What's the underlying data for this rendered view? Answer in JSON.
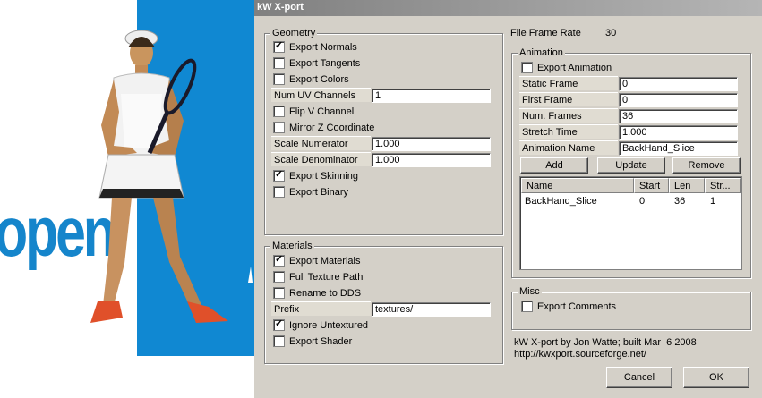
{
  "window": {
    "title": "kW X-port"
  },
  "geometry": {
    "title": "Geometry",
    "export_normals": {
      "label": "Export Normals",
      "checked": true
    },
    "export_tangents": {
      "label": "Export Tangents",
      "checked": false
    },
    "export_colors": {
      "label": "Export Colors",
      "checked": false
    },
    "num_uv_channels": {
      "label": "Num UV Channels",
      "value": "1"
    },
    "flip_v": {
      "label": "Flip V Channel",
      "checked": false
    },
    "mirror_z": {
      "label": "Mirror Z Coordinate",
      "checked": false
    },
    "scale_numerator": {
      "label": "Scale Numerator",
      "value": "1.000"
    },
    "scale_denominator": {
      "label": "Scale Denominator",
      "value": "1.000"
    },
    "export_skinning": {
      "label": "Export Skinning",
      "checked": true
    },
    "export_binary": {
      "label": "Export Binary",
      "checked": false
    }
  },
  "materials": {
    "title": "Materials",
    "export_materials": {
      "label": "Export Materials",
      "checked": true
    },
    "full_texture_path": {
      "label": "Full Texture Path",
      "checked": false
    },
    "rename_to_dds": {
      "label": "Rename to DDS",
      "checked": false
    },
    "prefix": {
      "label": "Prefix",
      "value": "textures/"
    },
    "ignore_untextured": {
      "label": "Ignore Untextured",
      "checked": true
    },
    "export_shader": {
      "label": "Export Shader",
      "checked": false
    }
  },
  "file_frame_rate": {
    "label": "File Frame Rate",
    "value": "30"
  },
  "animation": {
    "title": "Animation",
    "export_animation": {
      "label": "Export Animation",
      "checked": false
    },
    "static_frame": {
      "label": "Static Frame",
      "value": "0"
    },
    "first_frame": {
      "label": "First Frame",
      "value": "0"
    },
    "num_frames": {
      "label": "Num. Frames",
      "value": "36"
    },
    "stretch_time": {
      "label": "Stretch Time",
      "value": "1.000"
    },
    "animation_name": {
      "label": "Animation Name",
      "value": "BackHand_Slice"
    },
    "add_label": "Add",
    "update_label": "Update",
    "remove_label": "Remove",
    "list_columns": [
      "Name",
      "Start",
      "Len",
      "Str..."
    ],
    "list_rows": [
      [
        "BackHand_Slice",
        "0",
        "36",
        "1"
      ]
    ]
  },
  "misc": {
    "title": "Misc",
    "export_comments": {
      "label": "Export Comments",
      "checked": false
    }
  },
  "credits": {
    "line1": "kW X-port by Jon Watte; built Mar  6 2008",
    "line2": "http://kwxport.sourceforge.net/"
  },
  "buttons": {
    "cancel": "Cancel",
    "ok": "OK"
  },
  "background": {
    "wordmark": "open"
  },
  "colors": {
    "accent_blue": "#1088d2",
    "dialog_bg": "#d4d0c8"
  }
}
